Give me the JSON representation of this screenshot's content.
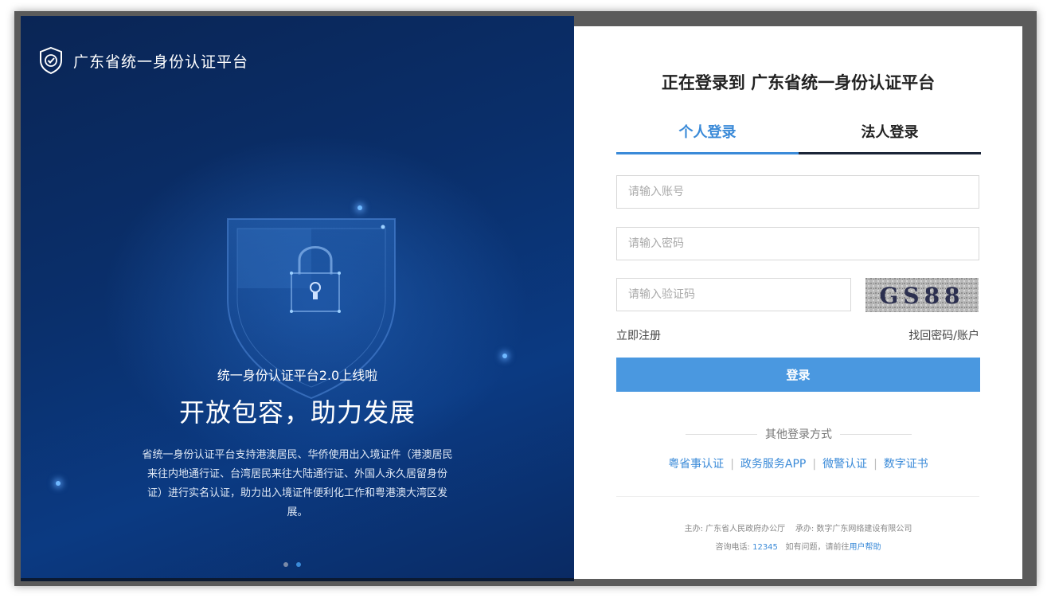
{
  "brand": {
    "name": "广东省统一身份认证平台",
    "icon": "shield-check-icon"
  },
  "promo": {
    "subtitle": "统一身份认证平台2.0上线啦",
    "headline": "开放包容，助力发展",
    "description": "省统一身份认证平台支持港澳居民、华侨使用出入境证件（港澳居民来往内地通行证、台湾居民来往大陆通行证、外国人永久居留身份证）进行实名认证，助力出入境证件便利化工作和粤港澳大湾区发展。",
    "carousel_pages": 2,
    "carousel_active": 2
  },
  "login": {
    "title": "正在登录到 广东省统一身份认证平台",
    "tabs": [
      {
        "label": "个人登录",
        "active": true
      },
      {
        "label": "法人登录",
        "active": false
      }
    ],
    "account_placeholder": "请输入账号",
    "password_placeholder": "请输入密码",
    "captcha_placeholder": "请输入验证码",
    "captcha_text": "GS88",
    "register_link": "立即注册",
    "recover_link": "找回密码/账户",
    "submit_label": "登录",
    "other_title": "其他登录方式",
    "methods": [
      "粤省事认证",
      "政务服务APP",
      "微警认证",
      "数字证书"
    ]
  },
  "footer": {
    "sponsor_label": "主办:",
    "sponsor": "广东省人民政府办公厅",
    "operator_label": "承办:",
    "operator": "数字广东网络建设有限公司",
    "phone_label": "咨询电话:",
    "phone": "12345",
    "help_text": "如有问题，请前往",
    "help_link": "用户帮助"
  },
  "colors": {
    "accent": "#4a98e0",
    "dark_bg": "#0a2f6b"
  }
}
